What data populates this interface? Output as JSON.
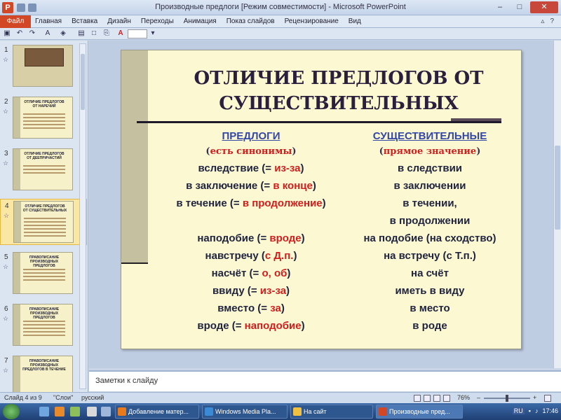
{
  "window": {
    "title": "Производные предлоги [Режим совместимости] - Microsoft PowerPoint",
    "minimize": "–",
    "maximize": "□",
    "close": "✕"
  },
  "ribbon": {
    "file": "Файл",
    "tabs": [
      "Главная",
      "Вставка",
      "Дизайн",
      "Переходы",
      "Анимация",
      "Показ слайдов",
      "Рецензирование",
      "Вид"
    ],
    "help": "?"
  },
  "qat": {
    "font_size": ""
  },
  "thumbnails": [
    {
      "num": "1",
      "title": ""
    },
    {
      "num": "2",
      "title": "ОТЛИЧИЕ ПРЕДЛОГОВ ОТ НАРЕЧИЙ"
    },
    {
      "num": "3",
      "title": "ОТЛИЧИЕ ПРЕДЛОГОВ ОТ ДЕЕПРИЧАСТИЙ"
    },
    {
      "num": "4",
      "title": "ОТЛИЧИЕ ПРЕДЛОГОВ ОТ СУЩЕСТВИТЕЛЬНЫХ"
    },
    {
      "num": "5",
      "title": "ПРАВОПИСАНИЕ ПРОИЗВОДНЫХ ПРЕДЛОГОВ"
    },
    {
      "num": "6",
      "title": "ПРАВОПИСАНИЕ ПРОИЗВОДНЫХ ПРЕДЛОГОВ"
    },
    {
      "num": "7",
      "title": "ПРАВОПИСАНИЕ ПРОИЗВОДНЫХ ПРЕДЛОГОВ В ТЕЧЕНИЕ"
    }
  ],
  "slide": {
    "title_line1": "ОТЛИЧИЕ ПРЕДЛОГОВ ОТ",
    "title_line2": "СУЩЕСТВИТЕЛЬНЫХ",
    "left_header": "ПРЕДЛОГИ",
    "left_sub_open": "(",
    "left_sub": "есть синонимы",
    "left_sub_close": ")",
    "right_header": "СУЩЕСТВИТЕЛЬНЫЕ",
    "right_sub_open": "(",
    "right_sub": "прямое значение",
    "right_sub_close": ")",
    "left_rows": [
      {
        "pre": "вследствие (= ",
        "red": "из-за",
        "post": ")"
      },
      {
        "pre": "в заключение (= ",
        "red": "в конце",
        "post": ")"
      },
      {
        "pre": "в течение (= ",
        "red": "в продолжение",
        "post": ")"
      },
      {
        "pre": "наподобие (= ",
        "red": "вроде",
        "post": ")"
      },
      {
        "pre": "навстречу (",
        "red": "с Д.п.",
        "post": ")"
      },
      {
        "pre": "насчёт (= ",
        "red": "о, об",
        "post": ")"
      },
      {
        "pre": "ввиду (= ",
        "red": "из-за",
        "post": ")"
      },
      {
        "pre": "вместо (= ",
        "red": "за",
        "post": ")"
      },
      {
        "pre": "вроде (= ",
        "red": "наподобие",
        "post": ")"
      }
    ],
    "right_rows": [
      "в следствии",
      "в заключении",
      "в течении,",
      "в продолжении",
      "на подобие (на сходство)",
      "на встречу (с Т.п.)",
      "на счёт",
      "иметь в виду",
      "в место",
      "в роде"
    ]
  },
  "notes": {
    "placeholder": "Заметки к слайду"
  },
  "status": {
    "slide": "Слайд 4 из 9",
    "theme": "\"Слои\"",
    "lang": "русский",
    "zoom": "76%",
    "zoom_minus": "–",
    "zoom_plus": "+",
    "zoom_level": 0.5
  },
  "taskbar": {
    "tasks": [
      "Добавление матер...",
      "Windows Media Pla...",
      "На сайт",
      "Производные пред..."
    ],
    "lang": "RU",
    "time": "17:46"
  }
}
